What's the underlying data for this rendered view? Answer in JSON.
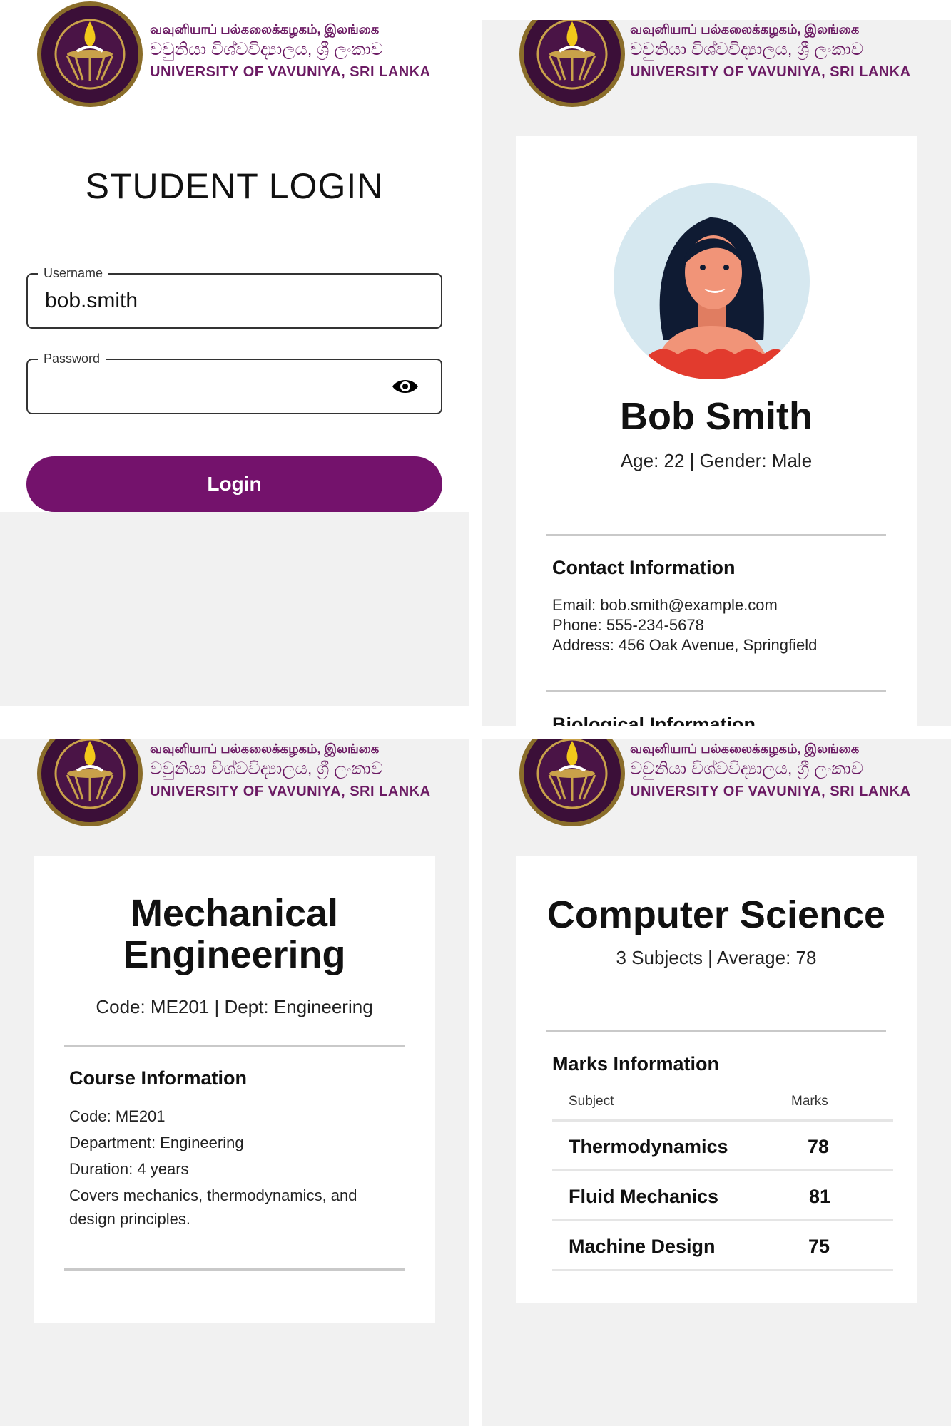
{
  "university": {
    "line_tamil": "வவுனியாப் பல்கலைக்கழகம், இலங்கை",
    "line_sinhala": "වවුනියා විශ්වවිද්‍යාලය, ශ්‍රී ලංකාව",
    "line_english": "UNIVERSITY OF VAVUNIYA, SRI LANKA",
    "colors": {
      "brand": "#6b1a63",
      "button": "#74126c"
    }
  },
  "login": {
    "title": "STUDENT LOGIN",
    "username_label": "Username",
    "username_value": "bob.smith",
    "password_label": "Password",
    "password_value": "",
    "password_toggle_icon": "eye-icon",
    "login_button": "Login"
  },
  "profile": {
    "name": "Bob Smith",
    "summary": "Age: 22 | Gender: Male",
    "contact_title": "Contact Information",
    "email": "Email: bob.smith@example.com",
    "phone": "Phone: 555-234-5678",
    "address": "Address: 456 Oak Avenue, Springfield",
    "bio_title": "Biological Information"
  },
  "course": {
    "title_line1": "Mechanical",
    "title_line2": "Engineering",
    "summary": "Code: ME201 | Dept: Engineering",
    "info_title": "Course Information",
    "code": "Code: ME201",
    "department": "Department: Engineering",
    "duration": "Duration: 4 years",
    "description_line1": "Covers mechanics, thermodynamics, and",
    "description_line2": "design principles."
  },
  "marks": {
    "title": "Computer Science",
    "summary": "3 Subjects | Average: 78",
    "info_title": "Marks Information",
    "col_subject": "Subject",
    "col_marks": "Marks",
    "rows": [
      {
        "subject": "Thermodynamics",
        "marks": "78"
      },
      {
        "subject": "Fluid Mechanics",
        "marks": "81"
      },
      {
        "subject": "Machine Design",
        "marks": "75"
      }
    ]
  }
}
